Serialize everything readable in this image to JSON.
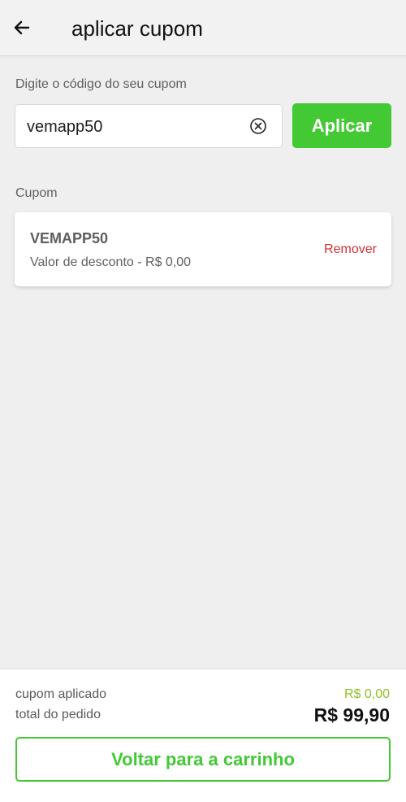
{
  "header": {
    "title": "aplicar cupom",
    "back_icon": "arrow-left-icon"
  },
  "coupon_form": {
    "label": "Digite o código do seu cupom",
    "input_value": "vemapp50",
    "clear_icon": "clear-circle-x-icon",
    "apply_label": "Aplicar"
  },
  "applied_coupon": {
    "section_label": "Cupom",
    "code": "VEMAPP50",
    "discount_text": "Valor de desconto - R$ 0,00",
    "remove_label": "Remover"
  },
  "summary": {
    "coupon_label": "cupom aplicado",
    "coupon_value": "R$ 0,00",
    "total_label": "total do pedido",
    "total_value": "R$ 99,90"
  },
  "footer": {
    "back_to_cart_label": "Voltar para a carrinho"
  },
  "colors": {
    "accent_green": "#42c934",
    "discount_green": "#8dc21f",
    "remove_red": "#d32f2f",
    "background": "#efefef"
  }
}
